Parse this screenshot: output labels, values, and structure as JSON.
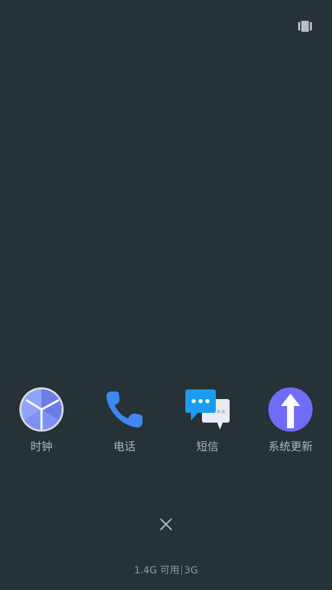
{
  "topbar": {
    "toggle_icon": "view-toggle-icon"
  },
  "apps": [
    {
      "label": "时钟",
      "icon": "clock-icon"
    },
    {
      "label": "电话",
      "icon": "phone-icon"
    },
    {
      "label": "短信",
      "icon": "messages-icon"
    },
    {
      "label": "系统更新",
      "icon": "update-arrow-icon"
    }
  ],
  "close_icon": "close-icon",
  "memory": {
    "available": "1.4G 可用",
    "total": "3G"
  },
  "colors": {
    "background": "#263237",
    "clock_face": "#8aa0f8",
    "phone": "#3f87f5",
    "message_blue": "#1a9cf1",
    "update_purple": "#6f6cf7"
  }
}
